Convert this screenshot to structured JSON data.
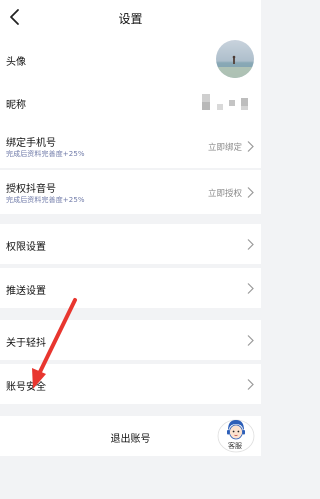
{
  "header": {
    "title": "设置"
  },
  "rows": {
    "avatar": {
      "label": "头像"
    },
    "nickname": {
      "label": "昵称"
    },
    "phone": {
      "label": "绑定手机号",
      "sub": "完成后资料完善度+25%",
      "action": "立即绑定"
    },
    "douyin": {
      "label": "授权抖音号",
      "sub": "完成后资料完善度+25%",
      "action": "立即授权"
    },
    "permissions": {
      "label": "权限设置"
    },
    "push": {
      "label": "推送设置"
    },
    "about": {
      "label": "关于轻抖"
    },
    "security": {
      "label": "账号安全"
    }
  },
  "logout": {
    "label": "退出账号"
  },
  "customer_service": {
    "label": "客服"
  },
  "colors": {
    "background": "#f2f3f5",
    "annotation_arrow": "#e8362f",
    "subtext": "#6f7aa8"
  }
}
